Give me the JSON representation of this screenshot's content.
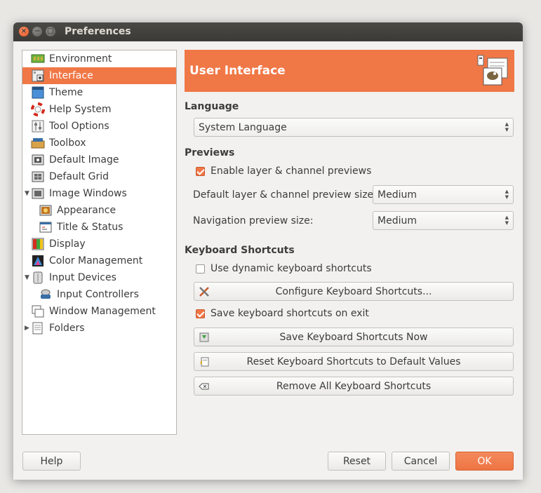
{
  "window": {
    "title": "Preferences"
  },
  "sidebar": {
    "items": [
      {
        "label": "Environment",
        "icon": "environment-icon"
      },
      {
        "label": "Interface",
        "icon": "interface-icon"
      },
      {
        "label": "Theme",
        "icon": "theme-icon"
      },
      {
        "label": "Help System",
        "icon": "help-system-icon"
      },
      {
        "label": "Tool Options",
        "icon": "tool-options-icon"
      },
      {
        "label": "Toolbox",
        "icon": "toolbox-icon"
      },
      {
        "label": "Default Image",
        "icon": "default-image-icon"
      },
      {
        "label": "Default Grid",
        "icon": "default-grid-icon"
      },
      {
        "label": "Image Windows",
        "icon": "image-windows-icon"
      },
      {
        "label": "Appearance",
        "icon": "appearance-icon"
      },
      {
        "label": "Title & Status",
        "icon": "title-status-icon"
      },
      {
        "label": "Display",
        "icon": "display-icon"
      },
      {
        "label": "Color Management",
        "icon": "color-management-icon"
      },
      {
        "label": "Input Devices",
        "icon": "input-devices-icon"
      },
      {
        "label": "Input Controllers",
        "icon": "input-controllers-icon"
      },
      {
        "label": "Window Management",
        "icon": "window-management-icon"
      },
      {
        "label": "Folders",
        "icon": "folders-icon"
      }
    ],
    "selected": "Interface"
  },
  "header": {
    "title": "User Interface",
    "icon": "gimp-interface-icon"
  },
  "language": {
    "section": "Language",
    "value": "System Language"
  },
  "previews": {
    "section": "Previews",
    "enable_label": "Enable layer & channel previews",
    "enable_checked": true,
    "layer_size_label": "Default layer & channel preview size:",
    "layer_size_value": "Medium",
    "nav_size_label": "Navigation preview size:",
    "nav_size_value": "Medium"
  },
  "shortcuts": {
    "section": "Keyboard Shortcuts",
    "dynamic_label": "Use dynamic keyboard shortcuts",
    "dynamic_checked": false,
    "configure_label": "Configure Keyboard Shortcuts...",
    "save_on_exit_label": "Save keyboard shortcuts on exit",
    "save_on_exit_checked": true,
    "save_now_label": "Save Keyboard Shortcuts Now",
    "reset_label": "Reset Keyboard Shortcuts to Default Values",
    "remove_label": "Remove All Keyboard Shortcuts"
  },
  "footer": {
    "help": "Help",
    "reset": "Reset",
    "cancel": "Cancel",
    "ok": "OK"
  },
  "colors": {
    "accent": "#f07746",
    "titlebar": "#3c3b37"
  }
}
